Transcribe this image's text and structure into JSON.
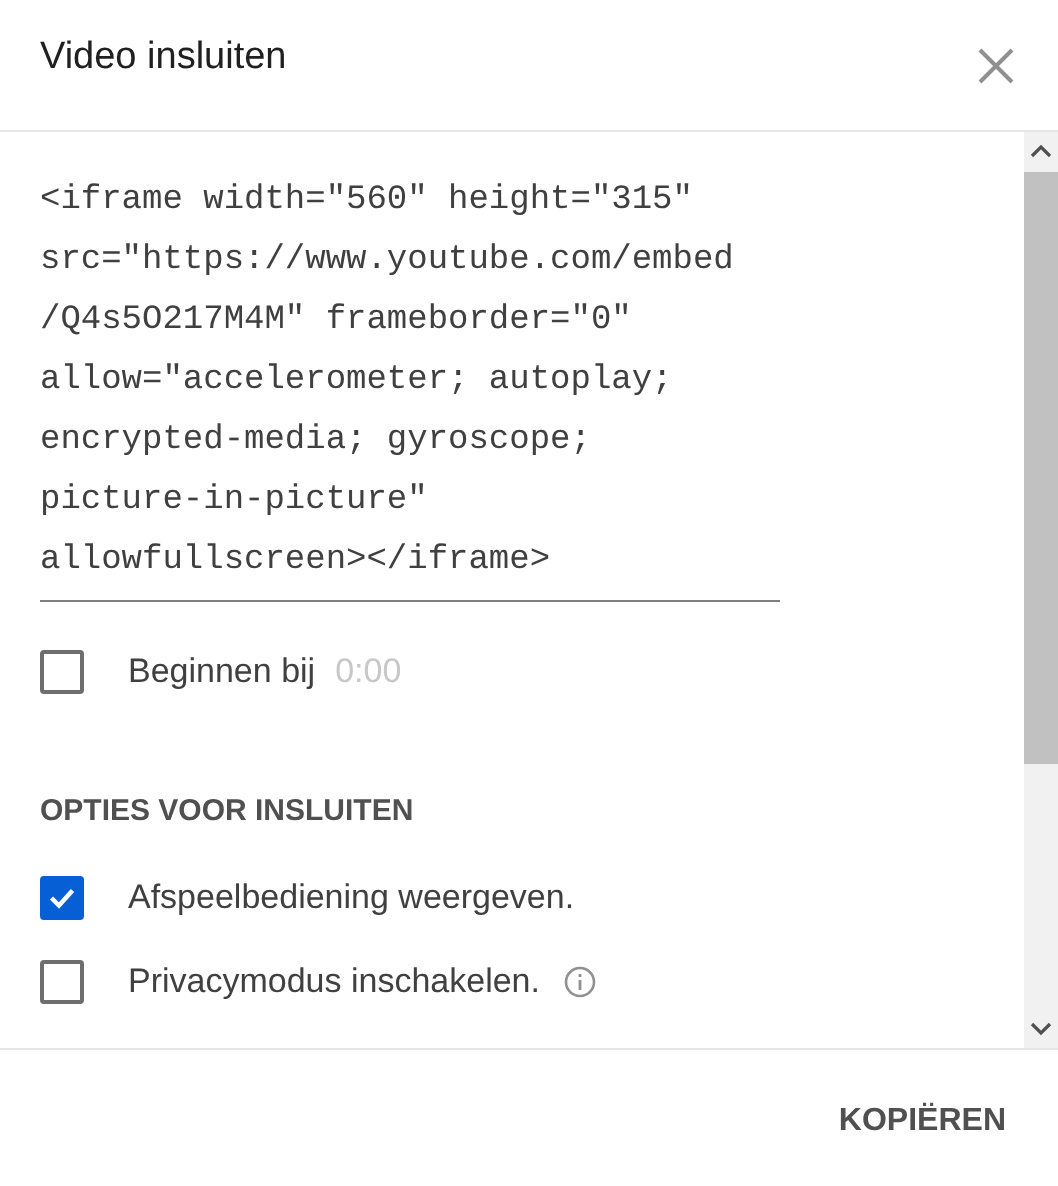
{
  "dialog": {
    "title": "Video insluiten"
  },
  "embed_code": "<iframe width=\"560\" height=\"315\"\nsrc=\"https://www.youtube.com/embed\n/Q4s5O217M4M\" frameborder=\"0\"\nallow=\"accelerometer; autoplay;\nencrypted-media; gyroscope;\npicture-in-picture\"\nallowfullscreen></iframe>",
  "start_at": {
    "label": "Beginnen bij",
    "checked": false,
    "placeholder": "0:00"
  },
  "section_heading": "OPTIES VOOR INSLUITEN",
  "options": [
    {
      "label": "Afspeelbediening weergeven.",
      "checked": true,
      "info": false
    },
    {
      "label": "Privacymodus inschakelen.",
      "checked": false,
      "info": true
    }
  ],
  "buttons": [
    "KOPIËREN"
  ]
}
